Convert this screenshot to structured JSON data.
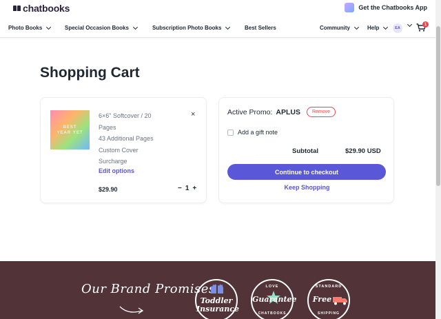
{
  "header": {
    "logo_text": "chatbooks",
    "get_app_label": "Get the Chatbooks App"
  },
  "nav": {
    "items": [
      {
        "label": "Photo Books",
        "has_dropdown": true
      },
      {
        "label": "Special Occasion Books",
        "has_dropdown": true
      },
      {
        "label": "Subscription Photo Books",
        "has_dropdown": true
      },
      {
        "label": "Best Sellers",
        "has_dropdown": false
      }
    ],
    "right_items": [
      {
        "label": "Community",
        "has_dropdown": true
      },
      {
        "label": "Help",
        "has_dropdown": true
      }
    ],
    "avatar_initials": "EA",
    "cart_count": "1"
  },
  "page": {
    "title": "Shopping Cart"
  },
  "cart_item": {
    "thumbnail_text": "BEST YEAR YET",
    "description_lines": [
      "6×6\" Softcover / 20",
      "Pages",
      "43 Additional Pages",
      "Custom Cover",
      "Surcharge"
    ],
    "edit_label": "Edit options",
    "remove_glyph": "×",
    "price": "$29.90",
    "quantity": "1",
    "decrement_glyph": "−",
    "increment_glyph": "+"
  },
  "summary": {
    "promo_label": "Active Promo:",
    "promo_code": "APLUS",
    "remove_label": "Remove",
    "gift_note_label": "Add a gift note",
    "gift_note_checked": false,
    "subtotal_label": "Subtotal",
    "subtotal_value": "$29.90 USD",
    "checkout_label": "Continue to checkout",
    "keep_shopping_label": "Keep Shopping"
  },
  "footer": {
    "promises_title": "Our Brand Promises",
    "badges": [
      {
        "top": "",
        "main": "Toddler Insurance",
        "bottom": ""
      },
      {
        "top": "LOVE",
        "main": "Guarantee",
        "bottom": "CHATBOOKS"
      },
      {
        "top": "STANDARD",
        "main": "Free",
        "bottom": "SHIPPING"
      }
    ]
  },
  "colors": {
    "accent": "#5a57d9",
    "danger": "#e2484f",
    "footer_bg": "#523337",
    "text_dark": "#1f2733"
  }
}
